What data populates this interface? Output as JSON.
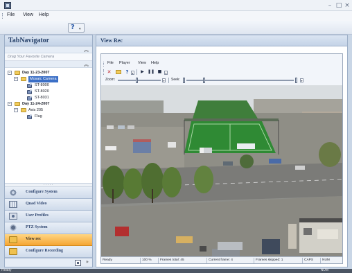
{
  "window": {
    "minimize": "–",
    "maximize": "□",
    "close": "×"
  },
  "menu": [
    "File",
    "View",
    "Help"
  ],
  "toolbar": {
    "help_glyph": "?",
    "dropdown_glyph": "▾"
  },
  "navigator": {
    "title": "TabNavigator",
    "drag_hint": "Drag Your Favorite Camera",
    "collapse_glyph": "«",
    "tree": [
      {
        "label": "Day 11-23-2007",
        "level": 0,
        "type": "folder",
        "expanded": true,
        "bold": true
      },
      {
        "label": "Mosaic Camera",
        "level": 1,
        "type": "folder",
        "expanded": true,
        "selected": true
      },
      {
        "label": "ST-8000",
        "level": 2,
        "type": "camera"
      },
      {
        "label": "ST-8020",
        "level": 2,
        "type": "camera"
      },
      {
        "label": "ST-8031",
        "level": 2,
        "type": "camera"
      },
      {
        "label": "Day 11-24-2007",
        "level": 0,
        "type": "folder",
        "expanded": true,
        "bold": true
      },
      {
        "label": "Axis 205",
        "level": 1,
        "type": "folder",
        "expanded": true
      },
      {
        "label": "Flug",
        "level": 2,
        "type": "camera"
      }
    ],
    "splitter_grip": "·····",
    "buttons": [
      {
        "label": "Configure System",
        "icon": "gear-icon",
        "active": false
      },
      {
        "label": "Quad Video",
        "icon": "grid-icon",
        "active": false
      },
      {
        "label": "User Profiles",
        "icon": "user-icon",
        "active": false
      },
      {
        "label": "PTZ System",
        "icon": "ptz-camera-icon",
        "active": false
      },
      {
        "label": "View rec",
        "icon": "folder-icon",
        "active": true
      },
      {
        "label": "Configure Recording",
        "icon": "folder-icon",
        "active": false
      }
    ],
    "footer_chevron": "»"
  },
  "view": {
    "title": "View Rec",
    "player_menu": [
      "File",
      "Player",
      "View",
      "Help"
    ],
    "zoom_label": "Zoom:",
    "seek_label": "Seek:",
    "status": {
      "state": "Ready",
      "zoom": "100 %",
      "frames_total": "Frames total: 45",
      "current_frame": "Current frame: 4",
      "frames_skipped": "Frames skipped: 1",
      "caps": "CAPS",
      "num": "NUM"
    }
  },
  "app_status": {
    "left": "Ready",
    "right": "NUM"
  },
  "colors": {
    "accent_active": "#f5a534",
    "panel_header": "#c4d3e7",
    "selection": "#3b6fc6"
  }
}
